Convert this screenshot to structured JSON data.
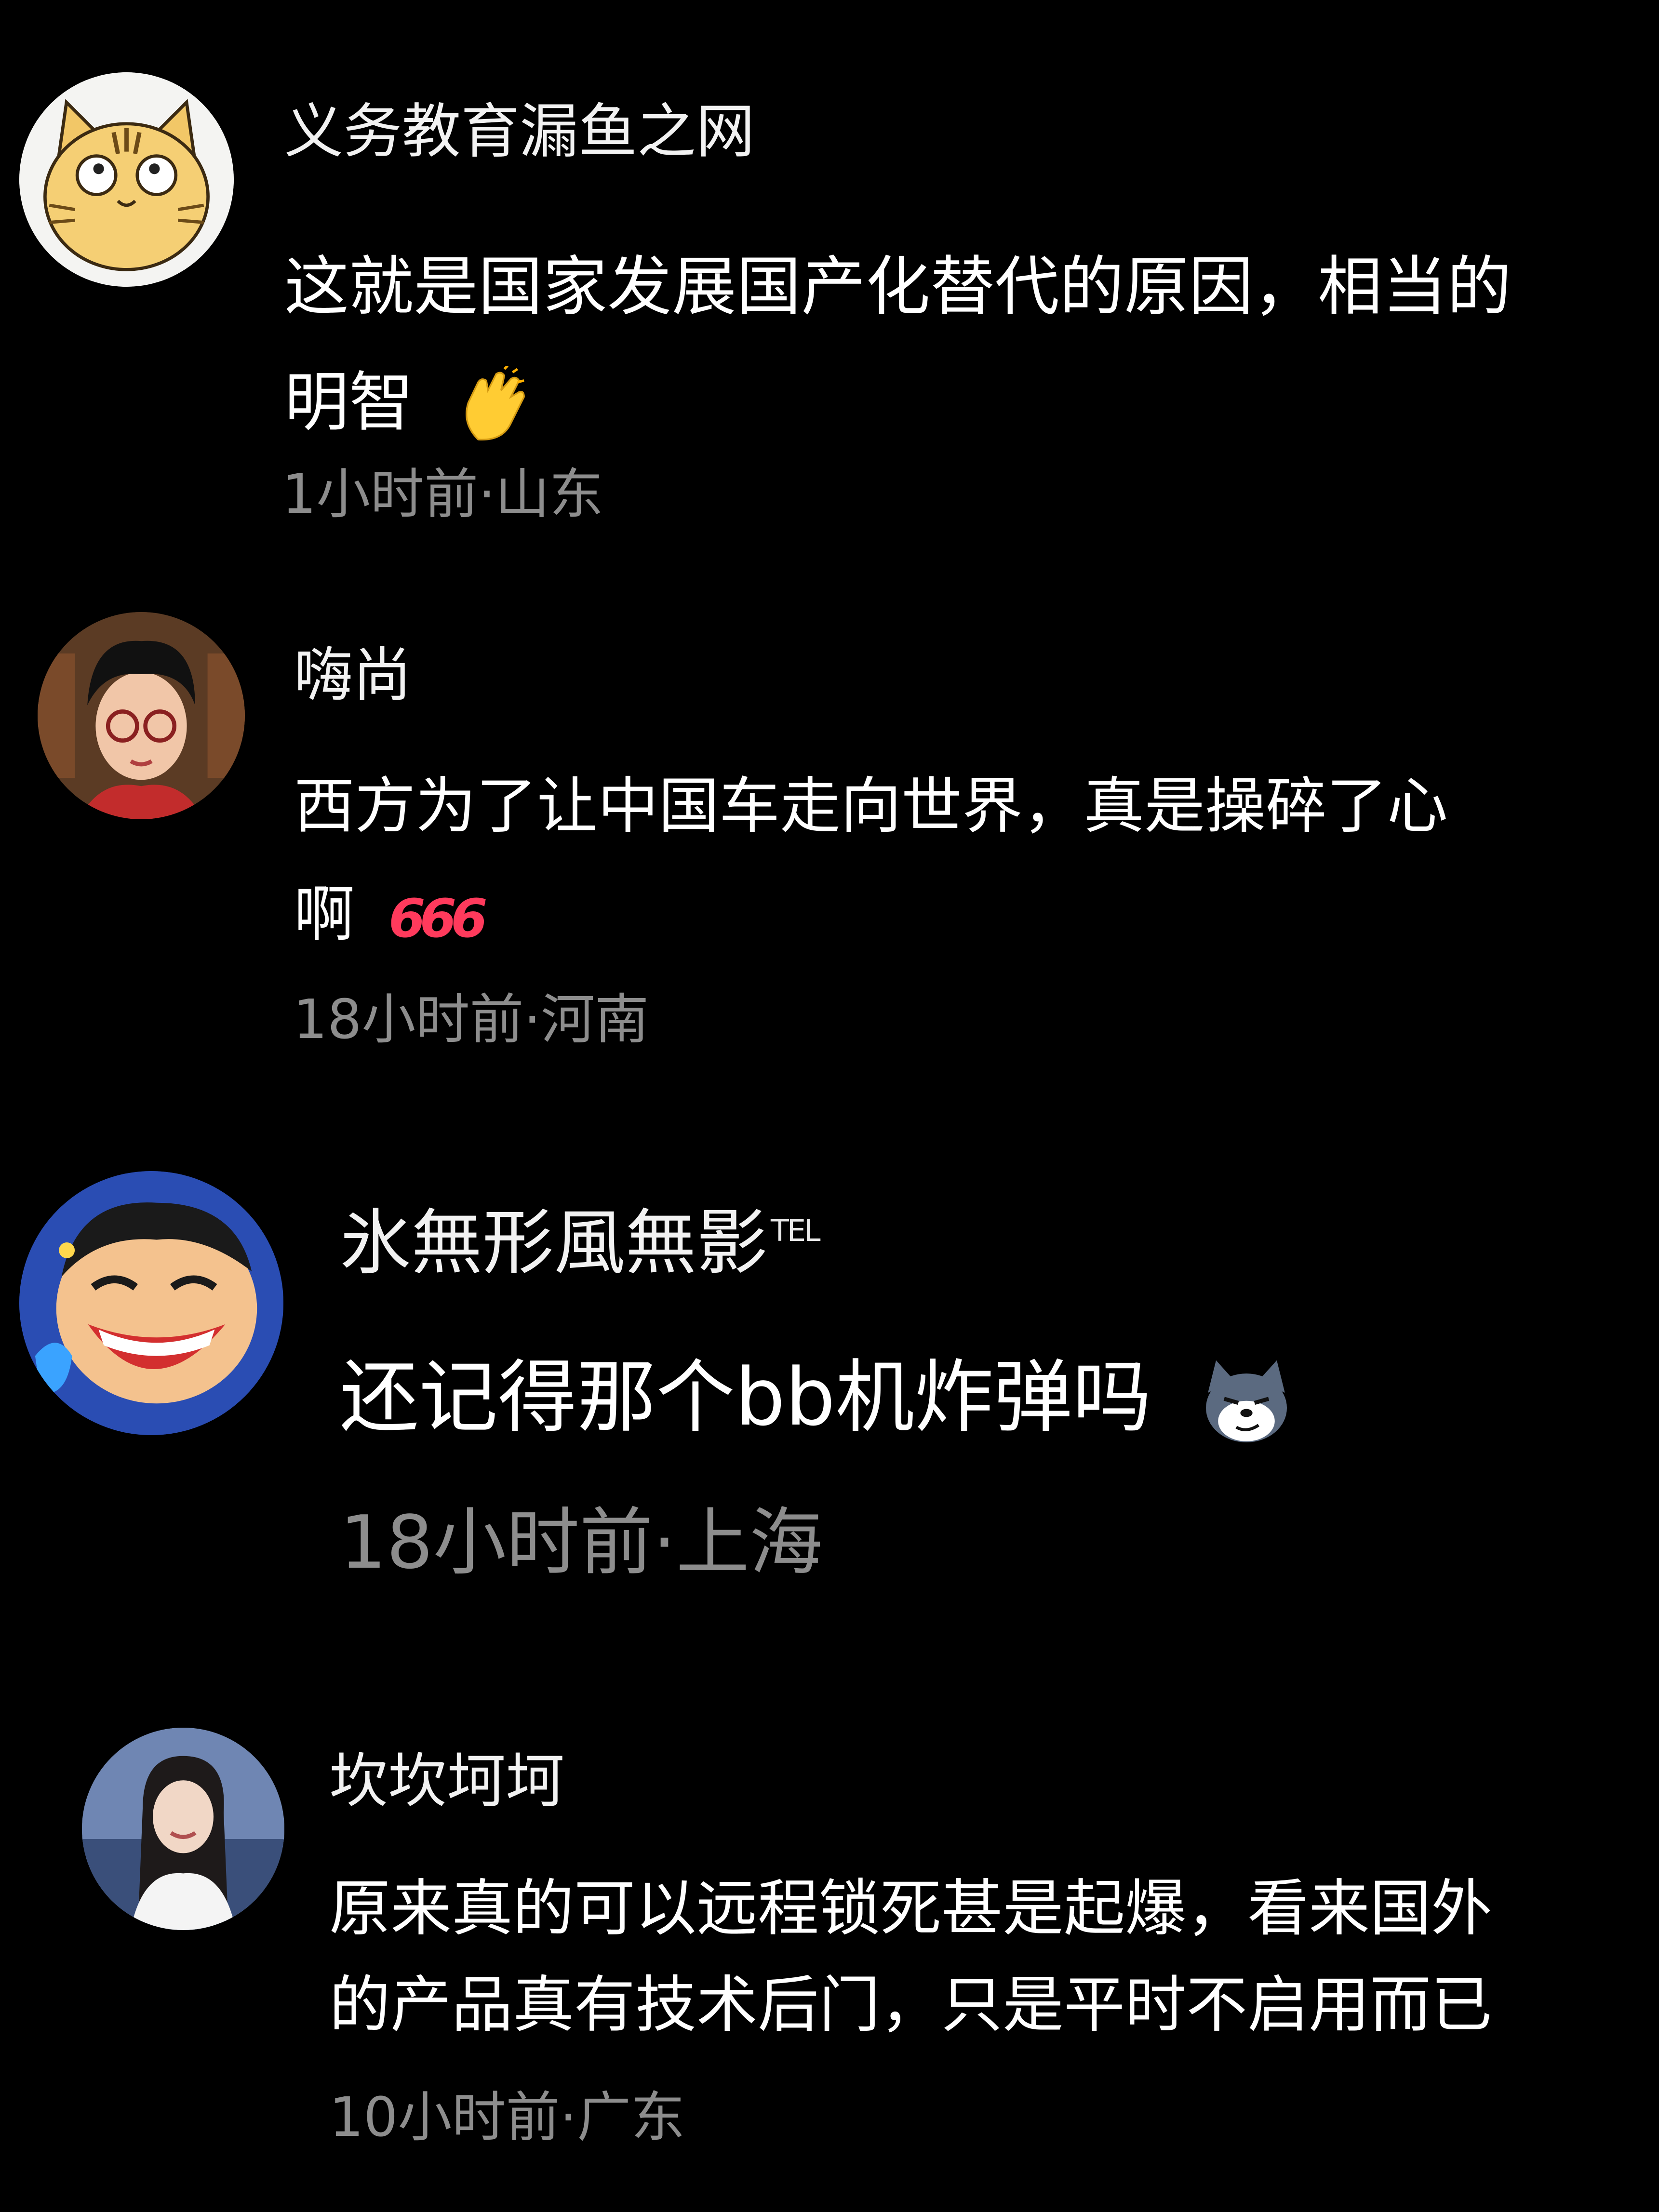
{
  "comments": [
    {
      "username": "义务教育漏鱼之网",
      "text_line1": "这就是国家发展国产化替代的原因，相当的",
      "text_line2": "明智",
      "emoji": "clap-emoji",
      "time": "1小时前",
      "separator": "·",
      "location": "山东"
    },
    {
      "username": "嗨尚",
      "text_line1": "西方为了让中国车走向世界，真是操碎了心",
      "text_line2": "啊",
      "emoji": "666-sticker",
      "emoji_text": "666",
      "time": "18小时前",
      "separator": "·",
      "location": "河南"
    },
    {
      "username": "氷無形風無影",
      "username_badge": "TEL",
      "text_line1": "还记得那个bb机炸弹吗",
      "emoji": "smug-dog-emoji",
      "time": "18小时前",
      "separator": "·",
      "location": "上海"
    },
    {
      "username": "坎坎坷坷",
      "text_line1": "原来真的可以远程锁死甚是起爆，看来国外",
      "text_line2": "的产品真有技术后门，只是平时不启用而已",
      "time": "10小时前",
      "separator": "·",
      "location": "广东"
    }
  ],
  "colors": {
    "background": "#000000",
    "text": "#ffffff",
    "meta": "#8d8d8d"
  }
}
